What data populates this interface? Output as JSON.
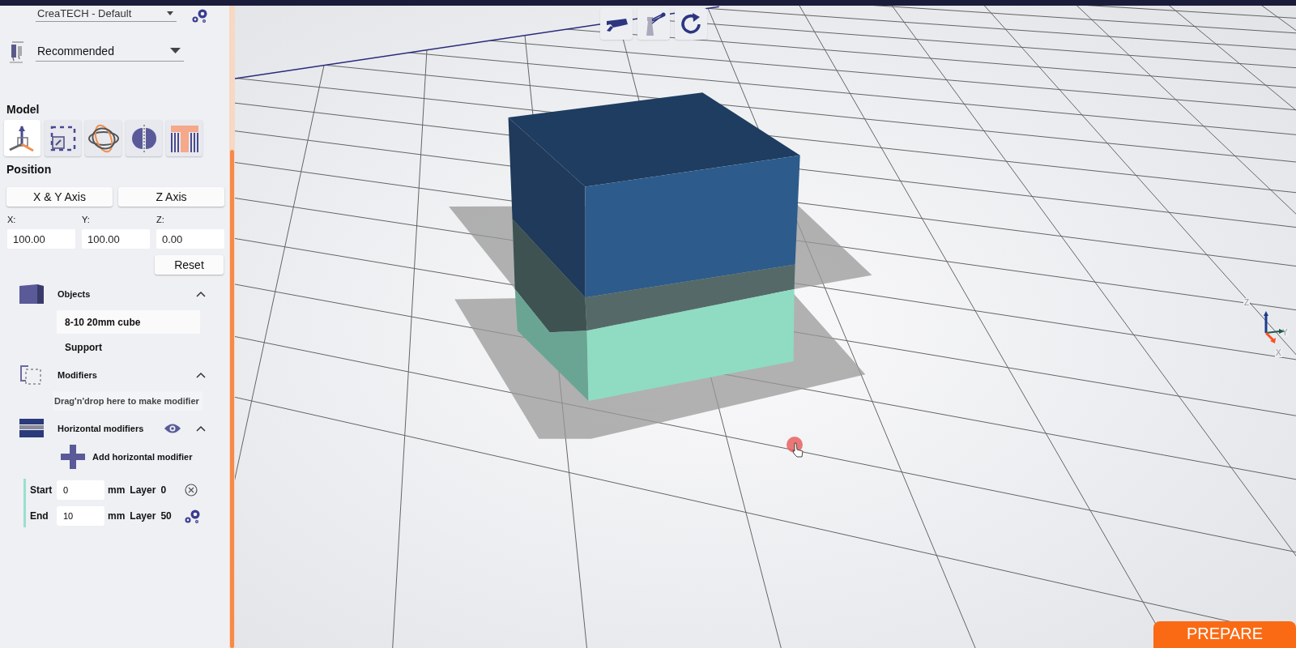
{
  "profile_dropdown": {
    "value": "CreaTECH - Default"
  },
  "quality_dropdown": {
    "value": "Recommended"
  },
  "model": {
    "title": "Model",
    "tools": [
      {
        "kind": "move",
        "selected": true
      },
      {
        "kind": "scale",
        "selected": false
      },
      {
        "kind": "rotate",
        "selected": false
      },
      {
        "kind": "mirror",
        "selected": false
      },
      {
        "kind": "support",
        "selected": false
      }
    ]
  },
  "position": {
    "title": "Position",
    "buttons": [
      "X & Y Axis",
      "Z Axis"
    ],
    "fields": [
      {
        "label": "X:",
        "value": "100.00"
      },
      {
        "label": "Y:",
        "value": "100.00"
      },
      {
        "label": "Z:",
        "value": "0.00"
      }
    ],
    "reset": "Reset"
  },
  "objects": {
    "title": "Objects",
    "expanded": true,
    "items": [
      {
        "label": "8-10 20mm cube",
        "selected": true
      },
      {
        "label": "Support",
        "selected": false
      }
    ]
  },
  "modifiers": {
    "title": "Modifiers",
    "expanded": true,
    "hint": "Drag'n'drop here to make modifier"
  },
  "horizontal_modifiers": {
    "title": "Horizontal modifiers",
    "expanded": true,
    "add_label": "Add horizontal modifier",
    "rows": [
      {
        "label": "Start",
        "value": "0",
        "unit": "mm",
        "layer_label": "Layer",
        "layer": "0",
        "kind": "remove"
      },
      {
        "label": "End",
        "value": "10",
        "unit": "mm",
        "layer_label": "Layer",
        "layer": "50",
        "kind": "settings"
      }
    ]
  },
  "viewport": {
    "axis_labels": [
      "Z",
      "Y",
      "X"
    ]
  },
  "prepare_button": "PREPARE"
}
